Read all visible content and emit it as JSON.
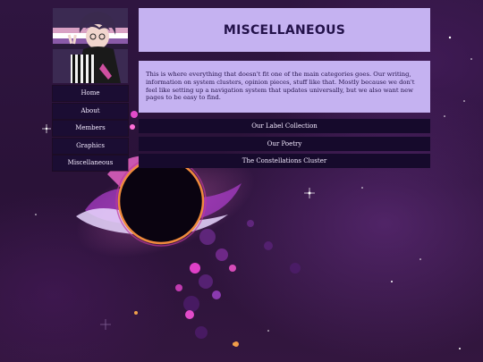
{
  "page": {
    "title": "Miscellaneous",
    "description": "This is where everything that doesn't fit one of the main categories goes. Our writing, information on system clusters, opinion pieces, stuff like that. Mostly because we don't feel like setting up a navigation system that updates universally, but we also want new pages to be easy to find."
  },
  "nav": {
    "items": [
      {
        "label": "Home"
      },
      {
        "label": "About"
      },
      {
        "label": "Members"
      },
      {
        "label": "Graphics"
      },
      {
        "label": "Miscellaneous"
      }
    ]
  },
  "links": [
    {
      "label": "Our Label Collection"
    },
    {
      "label": "Our Poetry"
    },
    {
      "label": "The Constellations Cluster"
    }
  ],
  "colors": {
    "panel": "#c5b2f1",
    "nav_bg": "#1b0d33",
    "text_dark": "#23124a",
    "background": "#2a1238"
  },
  "icons": {
    "avatar": "character-avatar",
    "background": "black-hole-space-art"
  }
}
